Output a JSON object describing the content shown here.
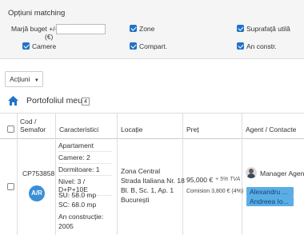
{
  "filters": {
    "title": "Opțiuni matching",
    "budget_label_line1": "Marjă buget +/-",
    "budget_label_line2": "(€)",
    "budget_value": "",
    "options": [
      {
        "label": "Zone",
        "checked": true
      },
      {
        "label": "Suprafață utilă",
        "checked": true
      },
      {
        "label": "Camere",
        "checked": true
      },
      {
        "label": "Compart.",
        "checked": true
      },
      {
        "label": "An constr.",
        "checked": true
      }
    ]
  },
  "actions_button": "Acțiuni",
  "portfolio": {
    "title": "Portofoliul meu",
    "count": "4"
  },
  "table": {
    "headers": {
      "code_line1": "Cod /",
      "code_line2": "Semafor",
      "characteristics": "Caracteristici",
      "location": "Locație",
      "price": "Preț",
      "agent": "Agent / Contacte"
    },
    "rows": [
      {
        "code": "CP753858",
        "badge": "A/R",
        "characteristics": [
          "Apartament",
          "Camere: 2",
          "Dormitoare: 1",
          "Nivel: 3 / D+P+10E",
          "SU: 58.0 mp",
          "SC: 68.0 mp",
          "An construcție:",
          "2005"
        ],
        "location": [
          "Zona Central",
          "Strada Italiana Nr. 18",
          "Bl. B, Sc. 1, Ap. 1",
          "București"
        ],
        "price": "95,000 €",
        "price_vat": "+ 5% TVA",
        "commission": "Comision 3,800 € (4%)",
        "agent_name": "Manager Agenti",
        "contacts": [
          "Alexandru ...",
          "Andreea Io..."
        ]
      }
    ]
  },
  "colors": {
    "accent": "#1f73c9",
    "badge": "#3a8fd6",
    "contact_tag": "#5aaee5"
  }
}
